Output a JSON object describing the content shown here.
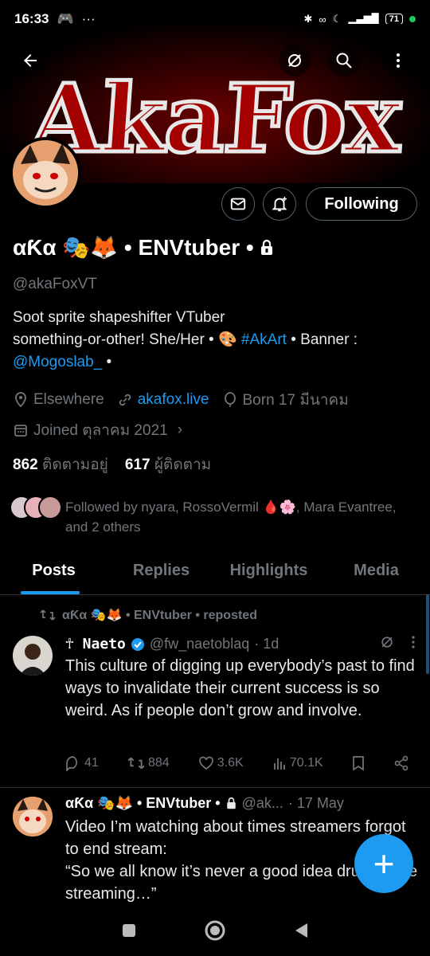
{
  "status": {
    "time": "16:33",
    "battery": "71"
  },
  "banner": {
    "title": "AkaFox"
  },
  "profile": {
    "name": "αƘα 🎭🦊 • ENVtuber •",
    "handle": "@akaFoxVT",
    "bio_line1": "Soot sprite shapeshifter VTuber",
    "bio_line2_pre": "something-or-other! She/Her • 🎨 ",
    "bio_hashtag": "#AkArt",
    "bio_line2_post": " • Banner :",
    "bio_mention": "@Mogoslab_",
    "bio_line3_post": " •",
    "location": "Elsewhere",
    "website": "akafox.live",
    "born": "Born 17 มีนาคม",
    "joined": "Joined ตุลาคม 2021",
    "following_count": "862",
    "following_label": "ติดตามอยู่",
    "followers_count": "617",
    "followers_label": "ผู้ติดตาม",
    "followed_by": "Followed by nyara, RossoVermil 🩸🌸, Mara Evantree, and 2 others"
  },
  "buttons": {
    "following": "Following"
  },
  "tabs": [
    "Posts",
    "Replies",
    "Highlights",
    "Media"
  ],
  "feed": {
    "repost_label": "αƘα 🎭🦊 • ENVtuber • reposted",
    "tweet1": {
      "name": "☥ Naeto",
      "handle": "@fw_naetoblaq",
      "time": "· 1d",
      "text": "This culture of digging up everybody’s past to find ways to invalidate their current success is so weird. As if people don’t grow and involve.",
      "replies": "41",
      "reposts": "884",
      "likes": "3.6K",
      "views": "70.1K"
    },
    "tweet2": {
      "name": "αƘα 🎭🦊 • ENVtuber •",
      "handle": "@ak...",
      "time": "· 17 May",
      "text": "Video I’m watching about times streamers forgot to end stream:\n“So we all know it’s never a good idea drunk while streaming…”"
    }
  },
  "colors": {
    "accent": "#1d9bf0",
    "background": "#000000",
    "muted": "#71767b"
  }
}
